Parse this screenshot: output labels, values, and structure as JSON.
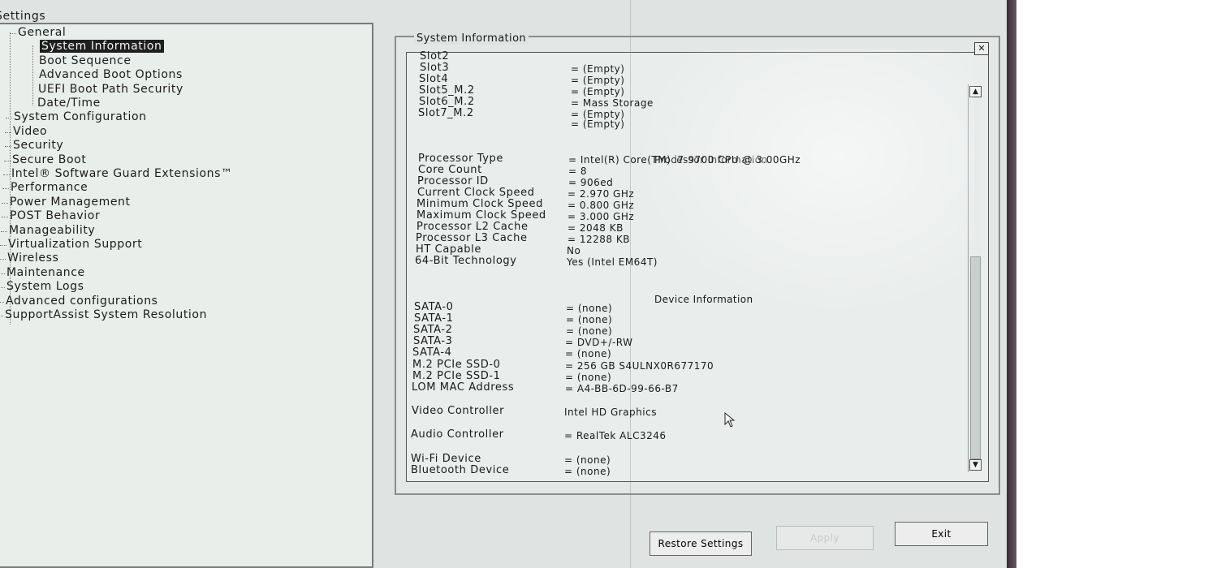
{
  "tree": {
    "root": "Settings",
    "items": [
      {
        "label": "General",
        "level": 1
      },
      {
        "label": "System Information",
        "level": 2,
        "selected": true
      },
      {
        "label": "Boot Sequence",
        "level": 2
      },
      {
        "label": "Advanced Boot Options",
        "level": 2
      },
      {
        "label": "UEFI Boot Path Security",
        "level": 2
      },
      {
        "label": "Date/Time",
        "level": 2
      },
      {
        "label": "System Configuration",
        "level": 1
      },
      {
        "label": "Video",
        "level": 1
      },
      {
        "label": "Security",
        "level": 1
      },
      {
        "label": "Secure Boot",
        "level": 1
      },
      {
        "label": "Intel® Software Guard Extensions™",
        "level": 1
      },
      {
        "label": "Performance",
        "level": 1
      },
      {
        "label": "Power Management",
        "level": 1
      },
      {
        "label": "POST Behavior",
        "level": 1
      },
      {
        "label": "Manageability",
        "level": 1
      },
      {
        "label": "Virtualization Support",
        "level": 1
      },
      {
        "label": "Wireless",
        "level": 1
      },
      {
        "label": "Maintenance",
        "level": 1
      },
      {
        "label": "System Logs",
        "level": 1
      },
      {
        "label": "Advanced configurations",
        "level": 1
      },
      {
        "label": "SupportAssist System Resolution",
        "level": 1
      }
    ]
  },
  "panel": {
    "title": "System Information",
    "close_icon": "close-icon",
    "slots": [
      {
        "label": "Slot2",
        "value": ""
      },
      {
        "label": "Slot3",
        "value": "= (Empty)"
      },
      {
        "label": "Slot4",
        "value": "= (Empty)"
      },
      {
        "label": "Slot5_M.2",
        "value": "= (Empty)"
      },
      {
        "label": "Slot6_M.2",
        "value": "= Mass Storage"
      },
      {
        "label": "Slot7_M.2",
        "value": "= (Empty)"
      },
      {
        "label": "",
        "value": "= (Empty)"
      }
    ],
    "processor_heading": "Processor Information",
    "processor": [
      {
        "label": "Processor Type",
        "value": "= Intel(R) Core(TM) i7-9700 CPU @ 3.00GHz"
      },
      {
        "label": "Core Count",
        "value": "= 8"
      },
      {
        "label": "Processor ID",
        "value": "= 906ed"
      },
      {
        "label": "Current Clock Speed",
        "value": "= 2.970 GHz"
      },
      {
        "label": "Minimum Clock Speed",
        "value": "= 0.800 GHz"
      },
      {
        "label": "Maximum Clock Speed",
        "value": "= 3.000 GHz"
      },
      {
        "label": "Processor L2 Cache",
        "value": "= 2048 KB"
      },
      {
        "label": "Processor L3 Cache",
        "value": "= 12288 KB"
      },
      {
        "label": "HT Capable",
        "value": "No"
      },
      {
        "label": "64-Bit Technology",
        "value": "Yes (Intel EM64T)"
      }
    ],
    "device_heading": "Device Information",
    "devices": [
      {
        "label": "SATA-0",
        "value": "= (none)"
      },
      {
        "label": "SATA-1",
        "value": "= (none)"
      },
      {
        "label": "SATA-2",
        "value": "= (none)"
      },
      {
        "label": "SATA-3",
        "value": "= DVD+/-RW"
      },
      {
        "label": "SATA-4",
        "value": "= (none)"
      },
      {
        "label": "M.2 PCIe SSD-0",
        "value": "= 256 GB S4ULNX0R677170"
      },
      {
        "label": "M.2 PCIe SSD-1",
        "value": "= (none)"
      },
      {
        "label": "LOM MAC Address",
        "value": "= A4-BB-6D-99-66-B7"
      },
      {
        "label": "Video Controller",
        "value": "Intel HD Graphics"
      },
      {
        "label": "Audio Controller",
        "value": "= RealTek ALC3246"
      },
      {
        "label": "Wi-Fi Device",
        "value": "= (none)"
      },
      {
        "label": "Bluetooth Device",
        "value": "= (none)"
      }
    ]
  },
  "buttons": {
    "restore": "Restore Settings",
    "apply": "Apply",
    "exit": "Exit"
  },
  "colors": {
    "selected_bg": "#1f1f1f",
    "bezel_accent": "#c9c4ff"
  }
}
